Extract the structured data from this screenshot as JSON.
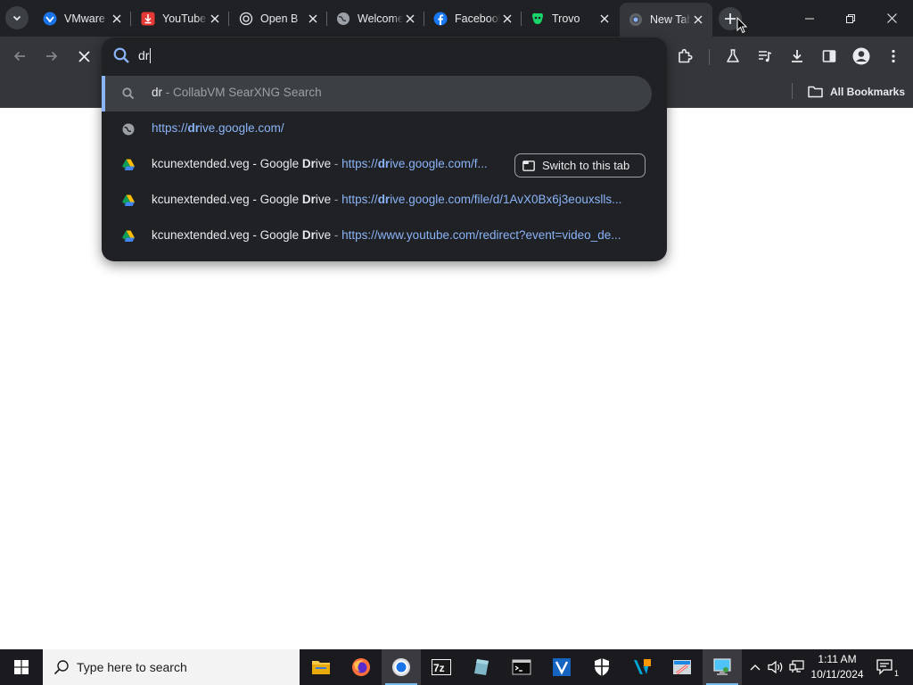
{
  "tabs": [
    {
      "title": "VMware",
      "favicon": "vmware-icon"
    },
    {
      "title": "YouTube",
      "favicon": "youtube-download-icon"
    },
    {
      "title": "Open B",
      "favicon": "chatgpt-icon"
    },
    {
      "title": "Welcome",
      "favicon": "globe-icon"
    },
    {
      "title": "Facebook",
      "favicon": "facebook-icon"
    },
    {
      "title": "Trovo",
      "favicon": "trovo-icon"
    },
    {
      "title": "New Tab",
      "favicon": "chrome-icon",
      "active": true
    }
  ],
  "omnibox": {
    "input_text": "dr",
    "suggestions": [
      {
        "type": "search",
        "icon": "search-icon",
        "query": "dr",
        "separator": " - ",
        "engine": "CollabVM SearXNG Search"
      },
      {
        "type": "url",
        "icon": "globe-icon",
        "url_prefix": "https://",
        "url_match": "dr",
        "url_rest": "ive.google.com/"
      },
      {
        "type": "history",
        "icon": "google-drive-icon",
        "title_pre": "kcunextended.veg - Google ",
        "title_match": "Dr",
        "title_post": "ive",
        "separator": " - ",
        "url_prefix": "https://",
        "url_match": "dr",
        "url_rest": "ive.google.com/f...",
        "button": "Switch to this tab"
      },
      {
        "type": "history",
        "icon": "google-drive-icon",
        "title_pre": "kcunextended.veg - Google ",
        "title_match": "Dr",
        "title_post": "ive",
        "separator": " - ",
        "url_prefix": "https://",
        "url_match": "dr",
        "url_rest": "ive.google.com/file/d/1AvX0Bx6j3eouxslls..."
      },
      {
        "type": "history",
        "icon": "google-drive-icon",
        "title_pre": "kcunextended.veg - Google ",
        "title_match": "Dr",
        "title_post": "ive",
        "separator": " - ",
        "url_full": "https://www.youtube.com/redirect?event=video_de..."
      }
    ]
  },
  "bookmarks_bar": {
    "all_bookmarks": "All Bookmarks"
  },
  "taskbar": {
    "search_placeholder": "Type here to search",
    "time": "1:11 AM",
    "date": "10/11/2024",
    "notification_count": "1"
  },
  "colors": {
    "titlebar": "#202124",
    "toolbar": "#35363a",
    "popup": "#202124",
    "accent": "#8ab4f8",
    "taskbar": "#1b1b1f"
  }
}
